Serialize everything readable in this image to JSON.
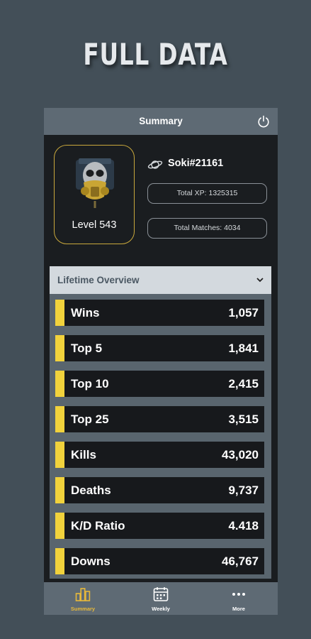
{
  "promo": {
    "title": "FULL DATA"
  },
  "header": {
    "title": "Summary",
    "power_icon": "power-icon"
  },
  "profile": {
    "username": "Soki#21161",
    "level": "Level 543",
    "total_xp": "Total XP: 1325315",
    "total_matches": "Total Matches: 4034",
    "avatar_icon": "gas-mask-skull-avatar",
    "accent_color": "#c9a83c"
  },
  "overview": {
    "label": "Lifetime Overview",
    "bar_color": "#f1d23c",
    "stats": [
      {
        "name": "Wins",
        "value": "1,057"
      },
      {
        "name": "Top 5",
        "value": "1,841"
      },
      {
        "name": "Top 10",
        "value": "2,415"
      },
      {
        "name": "Top 25",
        "value": "3,515"
      },
      {
        "name": "Kills",
        "value": "43,020"
      },
      {
        "name": "Deaths",
        "value": "9,737"
      },
      {
        "name": "K/D Ratio",
        "value": "4.418"
      },
      {
        "name": "Downs",
        "value": "46,767"
      }
    ]
  },
  "tabs": [
    {
      "label": "Summary",
      "icon": "bar-chart-icon",
      "active": true
    },
    {
      "label": "Weekly",
      "icon": "calendar-icon",
      "active": false
    },
    {
      "label": "More",
      "icon": "more-dots-icon",
      "active": false
    }
  ]
}
